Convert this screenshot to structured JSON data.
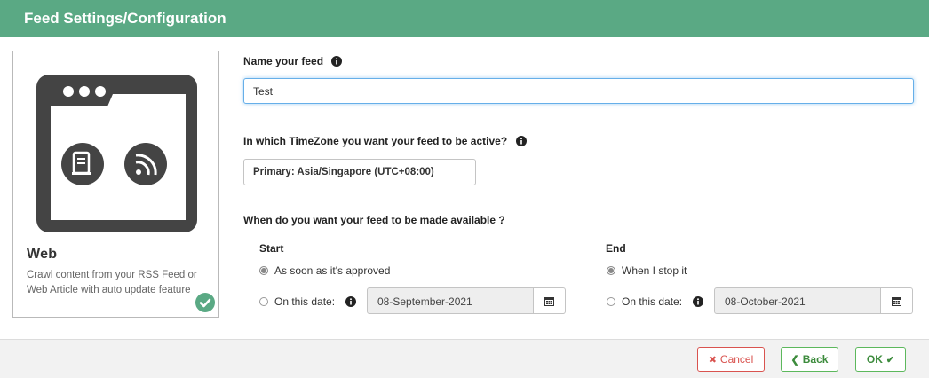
{
  "header": {
    "title": "Feed Settings/Configuration"
  },
  "source_card": {
    "icon": "browser-rss-icon",
    "title": "Web",
    "description": "Crawl content from your RSS Feed or Web Article with auto update feature",
    "selected": true
  },
  "name_field": {
    "label": "Name your feed",
    "value": "Test"
  },
  "timezone_field": {
    "label": "In which TimeZone you want your feed to be active?",
    "value": "Primary: Asia/Singapore (UTC+08:00)"
  },
  "availability": {
    "label": "When do you want your feed to be made available ?",
    "start": {
      "heading": "Start",
      "option_immediate": "As soon as it's approved",
      "option_date": "On this date:",
      "date_value": "08-September-2021",
      "selected": "immediate"
    },
    "end": {
      "heading": "End",
      "option_immediate": "When I stop it",
      "option_date": "On this date:",
      "date_value": "08-October-2021",
      "selected": "immediate"
    }
  },
  "footer": {
    "cancel_label": "Cancel",
    "back_label": "Back",
    "ok_label": "OK"
  },
  "colors": {
    "header": "#5aa984",
    "success": "#5cb85c",
    "danger": "#d9534f"
  }
}
